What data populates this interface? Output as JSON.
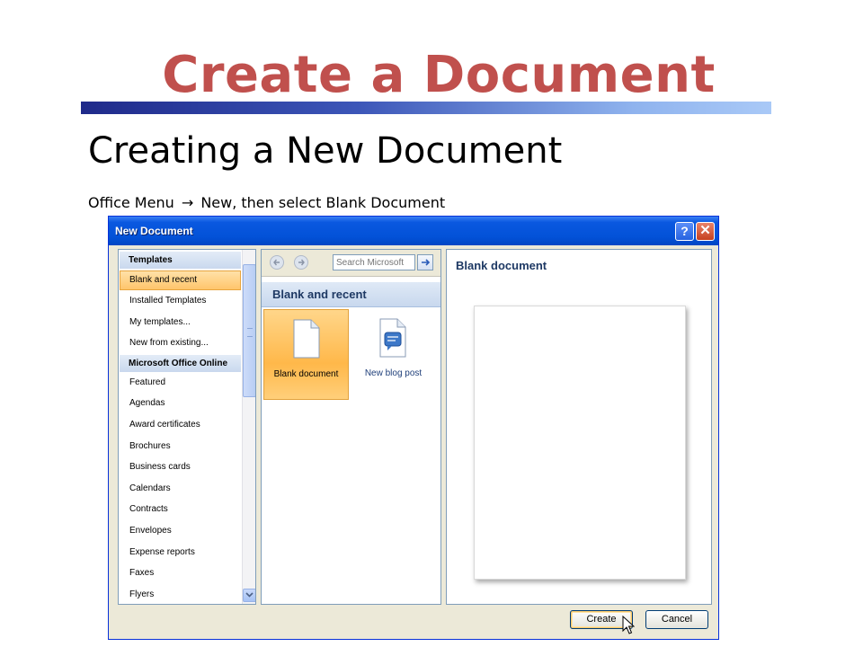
{
  "slide": {
    "title": "Create a Document",
    "subtitle": "Creating a New Document",
    "caption_left": "Office Menu",
    "caption_arrow": "→",
    "caption_right": "New, then select Blank Document"
  },
  "dialog": {
    "title": "New Document",
    "help_glyph": "?",
    "close_glyph": "✕",
    "sidebar": {
      "header_templates": "Templates",
      "items_top": [
        "Blank and recent",
        "Installed Templates",
        "My templates...",
        "New from existing..."
      ],
      "header_online": "Microsoft Office Online",
      "items_online": [
        "Featured",
        "Agendas",
        "Award certificates",
        "Brochures",
        "Business cards",
        "Calendars",
        "Contracts",
        "Envelopes",
        "Expense reports",
        "Faxes",
        "Flyers"
      ]
    },
    "search": {
      "placeholder": "Search Microsoft"
    },
    "section_title": "Blank and recent",
    "tiles": [
      {
        "label": "Blank document",
        "icon": "blank-document-icon"
      },
      {
        "label": "New blog post",
        "icon": "blog-post-icon"
      }
    ],
    "preview_title": "Blank document",
    "buttons": {
      "create": "Create",
      "cancel": "Cancel"
    }
  },
  "colors": {
    "title": "#c0504d",
    "titlebar": "#0352d8",
    "selection": "#ffc56b"
  }
}
